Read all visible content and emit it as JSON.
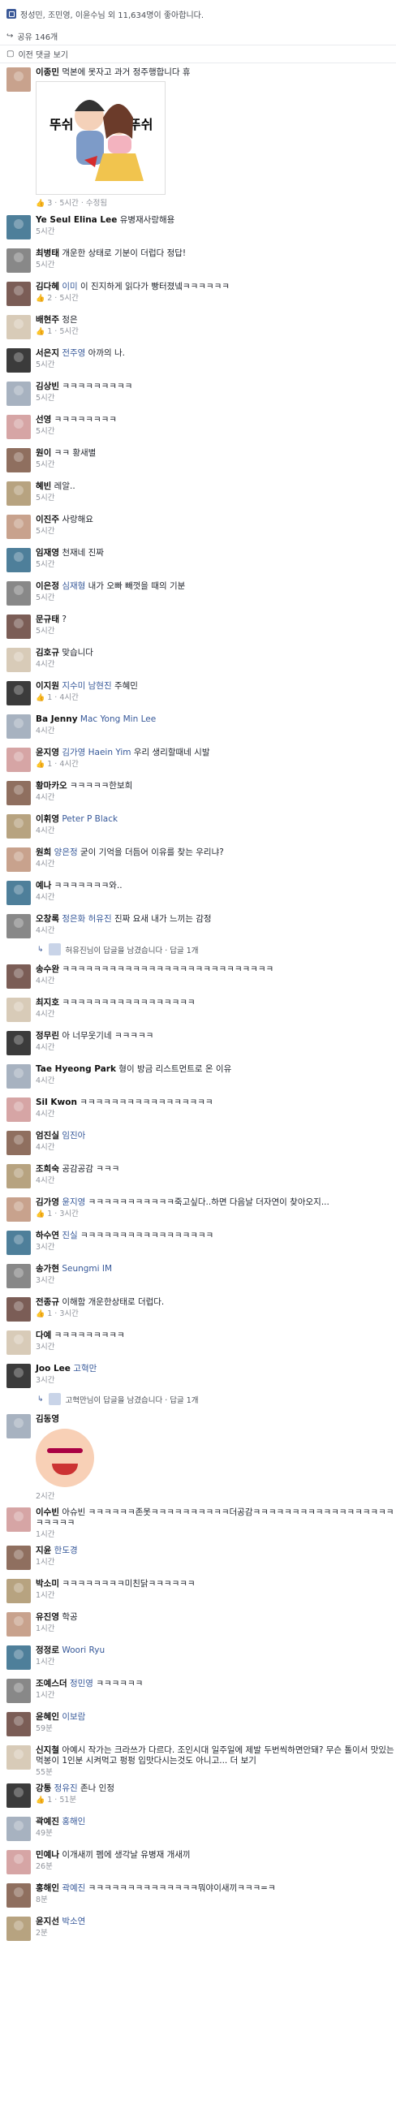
{
  "top": {
    "likes_text": "정성민, 조민영, 이윤수님 외 11,634명이 좋아합니다.",
    "shares_text": "공유 146개",
    "previous_comments": "이전 댓글 보기"
  },
  "sticker_words": [
    "뚜쉬",
    "뚜쉬"
  ],
  "comments": [
    {
      "name": "이종민",
      "text": "먹본에 못자고 과거 정주행합니다 휴",
      "meta": "3 · 5시간 · 수정됨",
      "sticker": true
    },
    {
      "name": "Ye Seul Elina Lee",
      "text": "유병재사랑해용",
      "meta": "5시간"
    },
    {
      "name": "최병태",
      "text": "개운한 상태로 기분이 더럽다 정답!",
      "meta": "5시간"
    },
    {
      "name": "김다혜",
      "tag": "이미",
      "text": "이 진지하게 읽다가 빵터졌넼ㅋㅋㅋㅋㅋㅋ",
      "meta": "2 · 5시간"
    },
    {
      "name": "배현주",
      "text": "정은",
      "meta": "1 · 5시간"
    },
    {
      "name": "서은지",
      "tag": "전주영",
      "text": "아까의 나.",
      "meta": "5시간"
    },
    {
      "name": "김상빈",
      "text": "ㅋㅋㅋㅋㅋㅋㅋㅋㅋ",
      "meta": "5시간"
    },
    {
      "name": "선영",
      "text": "ㅋㅋㅋㅋㅋㅋㅋㅋ",
      "meta": "5시간"
    },
    {
      "name": "원이",
      "text": "ㅋㅋ 황새별",
      "meta": "5시간"
    },
    {
      "name": "혜빈",
      "text": "레알..",
      "meta": "5시간"
    },
    {
      "name": "이진주",
      "text": "사랑해요",
      "meta": "5시간"
    },
    {
      "name": "임재영",
      "text": "천재네 진짜",
      "meta": "5시간"
    },
    {
      "name": "이은정",
      "tag": "심재형",
      "text": "내가 오빠 빼껏을 때의 기분",
      "meta": "5시간"
    },
    {
      "name": "문규태",
      "text": "?",
      "meta": "5시간"
    },
    {
      "name": "김호규",
      "text": "맞습니다",
      "meta": "4시간"
    },
    {
      "name": "이지원",
      "tag": "지수미 남현진",
      "text": "주혜민",
      "meta": "1 · 4시간"
    },
    {
      "name": "Ba Jenny",
      "tag": "Mac Yong Min Lee",
      "text": "",
      "meta": "4시간"
    },
    {
      "name": "윤지영",
      "tag": "김가영 Haein Yim",
      "text": "우리 생리할때네 시발",
      "meta": "1 · 4시간"
    },
    {
      "name": "황마카오",
      "text": "ㅋㅋㅋㅋㅋ한보희",
      "meta": "4시간"
    },
    {
      "name": "이휘영",
      "tag": "Peter P Black",
      "text": "",
      "meta": "4시간"
    },
    {
      "name": "원희",
      "tag": "양은정",
      "text": "굳이 기억을 더듬어 이유를 찾는 우리냐?",
      "meta": "4시간"
    },
    {
      "name": "예나",
      "text": "ㅋㅋㅋㅋㅋㅋㅋ와..",
      "meta": "4시간"
    },
    {
      "name": "오창록",
      "tag": "정은화 허유진",
      "text": "진짜 요새 내가 느끼는 감정",
      "meta": "4시간",
      "reply": "허유진님이 답글을 남겼습니다 · 답글 1개"
    },
    {
      "name": "송수완",
      "text": "ㅋㅋㅋㅋㅋㅋㅋㅋㅋㅋㅋㅋㅋㅋㅋㅋㅋㅋㅋㅋㅋㅋㅋㅋㅋㅋㅋ",
      "meta": "4시간"
    },
    {
      "name": "최지호",
      "text": "ㅋㅋㅋㅋㅋㅋㅋㅋㅋㅋㅋㅋㅋㅋㅋㅋㅋ",
      "meta": "4시간"
    },
    {
      "name": "정무린",
      "text": "아 너무웃기네 ㅋㅋㅋㅋㅋ",
      "meta": "4시간"
    },
    {
      "name": "Tae Hyeong Park",
      "text": "형이 방금 리스트먼트로 온 이유",
      "meta": "4시간"
    },
    {
      "name": "Sil Kwon",
      "text": "ㅋㅋㅋㅋㅋㅋㅋㅋㅋㅋㅋㅋㅋㅋㅋㅋㅋ",
      "meta": "4시간"
    },
    {
      "name": "엄진실",
      "tag": "임진아",
      "text": "",
      "meta": "4시간"
    },
    {
      "name": "조희숙",
      "text": "공감공감 ㅋㅋㅋ",
      "meta": "4시간"
    },
    {
      "name": "김가영",
      "tag": "윤지영",
      "text": "ㅋㅋㅋㅋㅋㅋㅋㅋㅋㅋㅋ죽고싶다..하면 다음날 더자연이 찾아오지...",
      "meta": "1 · 3시간"
    },
    {
      "name": "하수연",
      "tag": "진실",
      "text": "ㅋㅋㅋㅋㅋㅋㅋㅋㅋㅋㅋㅋㅋㅋㅋㅋㅋ",
      "meta": "3시간"
    },
    {
      "name": "송가현",
      "tag": "Seungmi IM",
      "text": "",
      "meta": "3시간"
    },
    {
      "name": "전종규",
      "text": "이해함 개운한상태로 더럽다.",
      "meta": "1 · 3시간"
    },
    {
      "name": "다예",
      "text": "ㅋㅋㅋㅋㅋㅋㅋㅋㅋ",
      "meta": "3시간"
    },
    {
      "name": "Joo Lee",
      "tag": "고혁만",
      "text": "",
      "meta": "3시간",
      "reply": "고혁만님이 답글을 남겼습니다 · 답글 1개"
    },
    {
      "name": "김동영",
      "text": "",
      "meta": "2시간",
      "big": true
    },
    {
      "name": "이수빈",
      "text": "아슈빈 ㅋㅋㅋㅋㅋㅋ존못ㅋㅋㅋㅋㅋㅋㅋㅋㅋㅋ더공감ㅋㅋㅋㅋㅋㅋㅋㅋㅋㅋㅋㅋㅋㅋㅋㅋㅋㅋㅋㅋㅋㅋㅋ",
      "meta": "1시간"
    },
    {
      "name": "지윤",
      "tag": "한도경",
      "text": "",
      "meta": "1시간"
    },
    {
      "name": "박소미",
      "text": "ㅋㅋㅋㅋㅋㅋㅋㅋ미친닭ㅋㅋㅋㅋㅋㅋ",
      "meta": "1시간"
    },
    {
      "name": "유진영",
      "text": "학공",
      "meta": "1시간"
    },
    {
      "name": "정정로",
      "tag": "Woori Ryu",
      "text": "",
      "meta": "1시간"
    },
    {
      "name": "조예스더",
      "tag": "정민영",
      "text": "ㅋㅋㅋㅋㅋㅋ",
      "meta": "1시간"
    },
    {
      "name": "윤혜인",
      "tag": "이보람",
      "text": "",
      "meta": "59분"
    },
    {
      "name": "신지철",
      "text": "아예시 작가는 크라쓰가 다르다. 조인시대 일주일에 제발 두번씩하면안돼? 무슨 톨이서 맛있는 먹봉이 1인분 시켜먹고 펑펑 입맛다시는것도 아니고... 더 보기",
      "meta": "55분",
      "multi": true
    },
    {
      "name": "강통",
      "tag": "정유진",
      "text": "존나 인정",
      "meta": "1 · 51분"
    },
    {
      "name": "곽예진",
      "tag": "홍해인",
      "text": "",
      "meta": "49분"
    },
    {
      "name": "민예나",
      "text": "이개새끼 펨에 생각날 유병재 개새끼",
      "meta": "26분"
    },
    {
      "name": "홍해인",
      "tag": "곽예진",
      "text": "ㅋㅋㅋㅋㅋㅋㅋㅋㅋㅋㅋㅋㅋㅋ뭐야이새끼ㅋㅋㅋ=ㅋ",
      "meta": "8분"
    },
    {
      "name": "윤지선",
      "tag": "박소연",
      "text": "",
      "meta": "2분"
    }
  ]
}
